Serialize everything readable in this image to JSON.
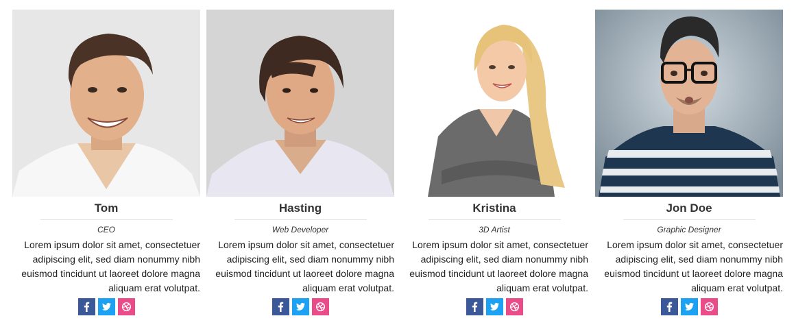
{
  "colors": {
    "facebook": "#3b5998",
    "twitter": "#1da1f2",
    "dribbble": "#ea4c89",
    "divider": "#e3e3e3"
  },
  "members": [
    {
      "name": "Tom",
      "role": "CEO",
      "bio": "Lorem ipsum dolor sit amet, consectetuer\nadipiscing elit, sed diam nonummy nibh\neuismod tincidunt ut laoreet dolore magna\naliquam erat volutpat.",
      "social": [
        "facebook-icon",
        "twitter-icon",
        "dribbble-icon"
      ]
    },
    {
      "name": "Hasting",
      "role": "Web Developer",
      "bio": "Lorem ipsum dolor sit amet, consectetuer\nadipiscing elit, sed diam nonummy nibh\neuismod tincidunt ut laoreet dolore magna\naliquam erat volutpat.",
      "social": [
        "facebook-icon",
        "twitter-icon",
        "dribbble-icon"
      ]
    },
    {
      "name": "Kristina",
      "role": "3D Artist",
      "bio": "Lorem ipsum dolor sit amet, consectetuer\nadipiscing elit, sed diam nonummy nibh\neuismod tincidunt ut laoreet dolore magna\naliquam erat volutpat.",
      "social": [
        "facebook-icon",
        "twitter-icon",
        "dribbble-icon"
      ]
    },
    {
      "name": "Jon Doe",
      "role": "Graphic Designer",
      "bio": "Lorem ipsum dolor sit amet, consectetuer\nadipiscing elit, sed diam nonummy nibh\neuismod tincidunt ut laoreet dolore magna\naliquam erat volutpat.",
      "social": [
        "facebook-icon",
        "twitter-icon",
        "dribbble-icon"
      ]
    }
  ]
}
